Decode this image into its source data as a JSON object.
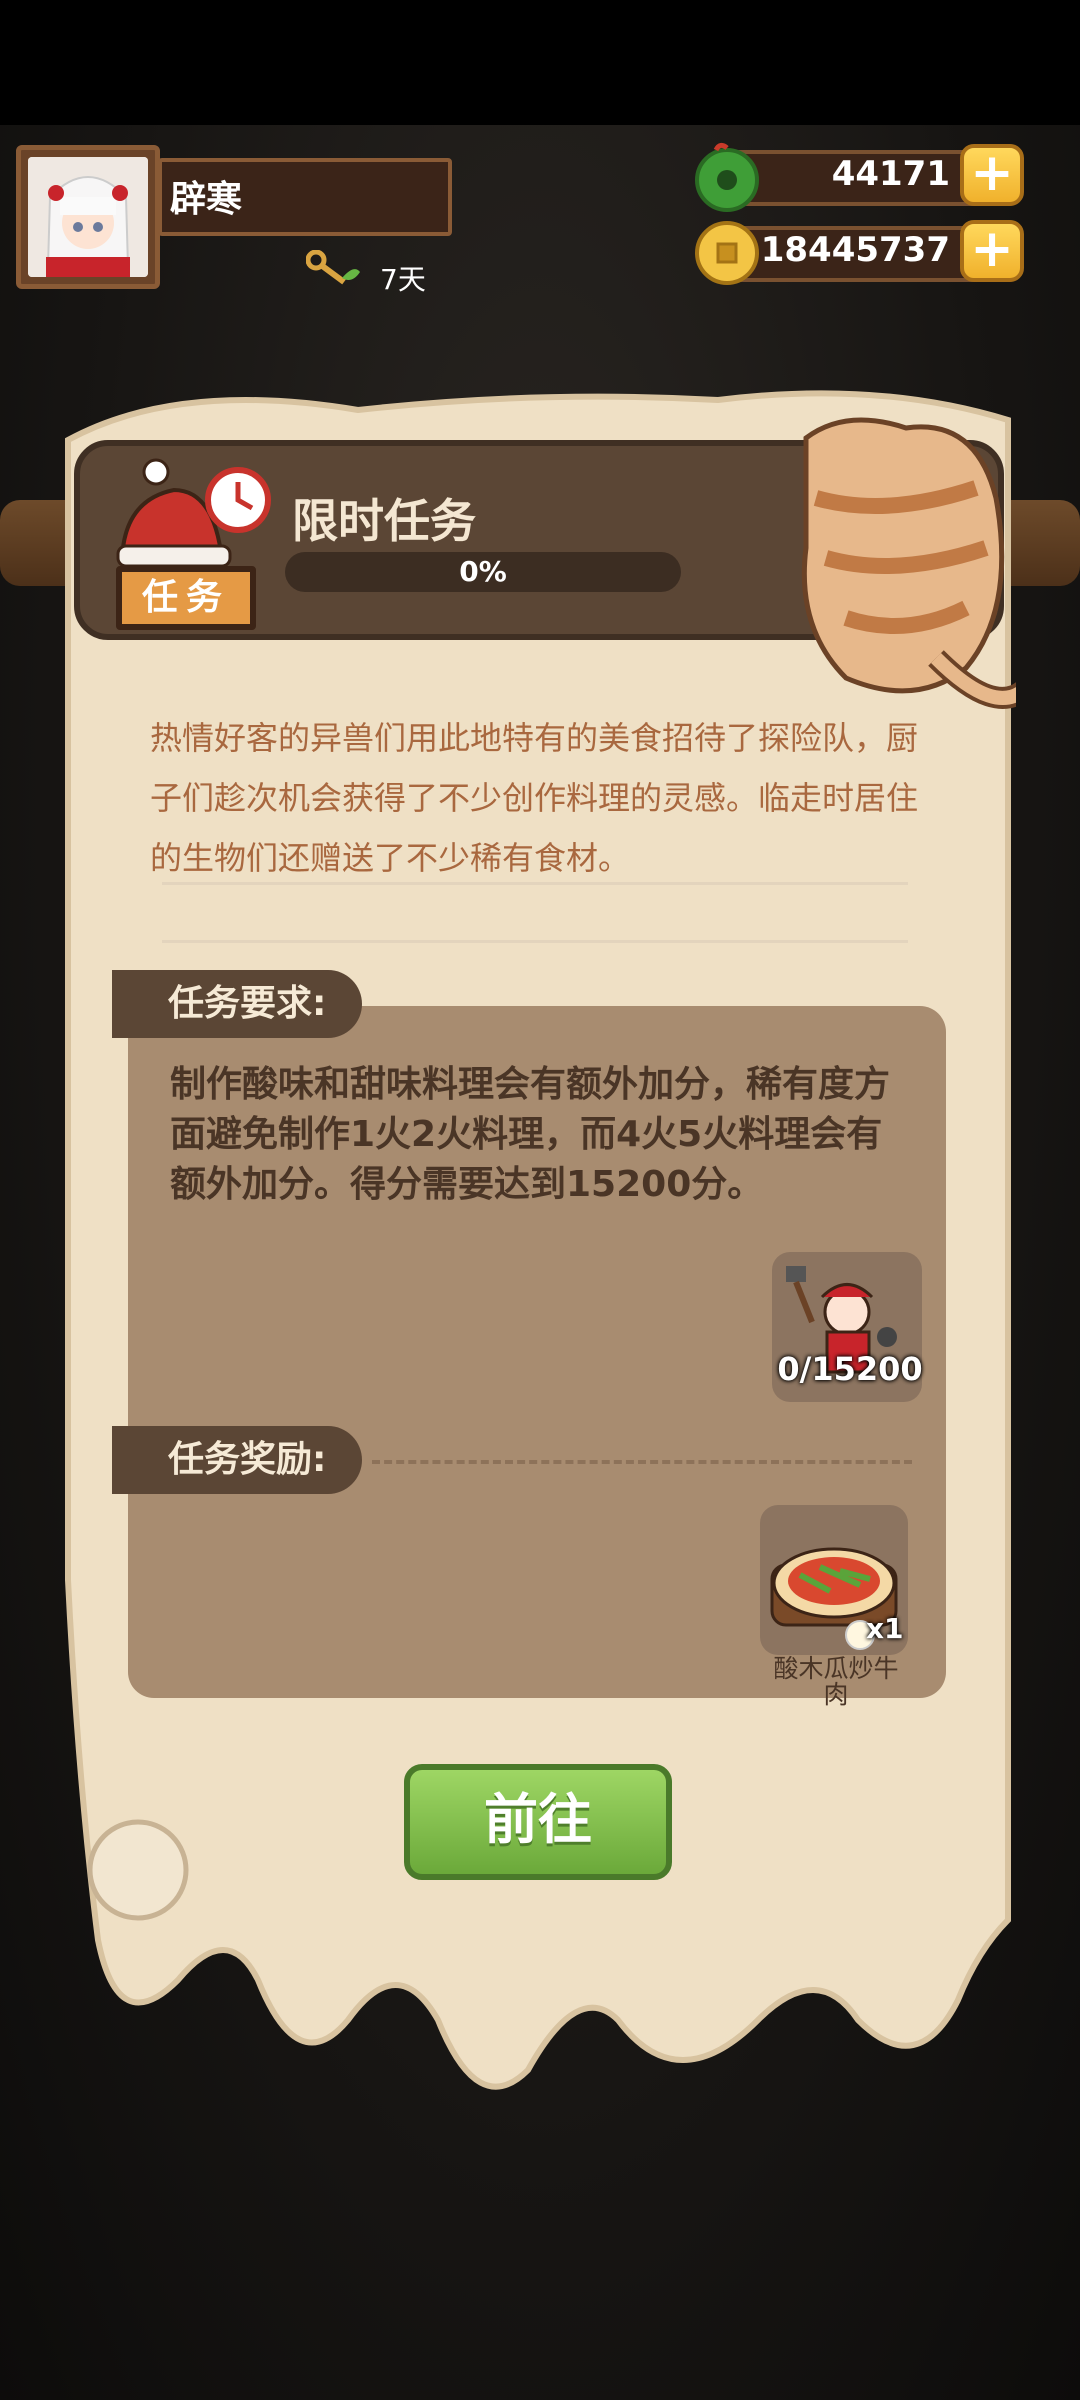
{
  "player": {
    "name": "辟寒",
    "level_label": "7天",
    "avatar_icon": "character-avatar-icon"
  },
  "currencies": [
    {
      "name": "jade",
      "icon": "jade-coin-icon",
      "value": "44171"
    },
    {
      "name": "gold",
      "icon": "gold-coin-icon",
      "value": "18445737"
    }
  ],
  "task": {
    "badge": "任务",
    "title": "限时任务",
    "progress_text": "0%",
    "progress_value": 0,
    "description": "热情好客的异兽们用此地特有的美食招待了探险队，厨子们趁次机会获得了不少创作料理的灵感。临走时居住的生物们还赠送了不少稀有食材。",
    "requirement_label": "任务要求:",
    "requirement_text": "制作酸味和甜味料理会有额外加分，稀有度方面避免制作1火2火料理，而4火5火料理会有额外加分。得分需要达到15200分。",
    "requirement_progress": "0/15200",
    "reward_label": "任务奖励:",
    "reward_item_name": "酸木瓜炒牛肉",
    "reward_item_qty": "x1",
    "go_button": "前往"
  },
  "colors": {
    "accent_green": "#7cbd47",
    "paper": "#efe0c5",
    "dark_brown": "#5b4635",
    "desc_text": "#a9683f"
  }
}
